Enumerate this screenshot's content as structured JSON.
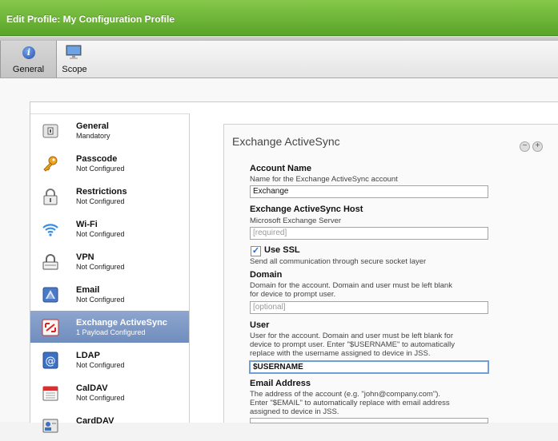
{
  "window": {
    "title": "Edit Profile: My Configuration Profile"
  },
  "tabs": [
    {
      "label": "General"
    },
    {
      "label": "Scope"
    }
  ],
  "sidebar": {
    "items": [
      {
        "name": "General",
        "status": "Mandatory"
      },
      {
        "name": "Passcode",
        "status": "Not Configured"
      },
      {
        "name": "Restrictions",
        "status": "Not Configured"
      },
      {
        "name": "Wi-Fi",
        "status": "Not Configured"
      },
      {
        "name": "VPN",
        "status": "Not Configured"
      },
      {
        "name": "Email",
        "status": "Not Configured"
      },
      {
        "name": "Exchange ActiveSync",
        "status": "1 Payload Configured"
      },
      {
        "name": "LDAP",
        "status": "Not Configured"
      },
      {
        "name": "CalDAV",
        "status": "Not Configured"
      },
      {
        "name": "CardDAV",
        "status": ""
      }
    ]
  },
  "panel": {
    "title": "Exchange ActiveSync",
    "minus": "−",
    "plus": "+",
    "account_name": {
      "label": "Account Name",
      "desc": "Name for the Exchange ActiveSync account",
      "value": "Exchange"
    },
    "host": {
      "label": "Exchange ActiveSync Host",
      "desc": "Microsoft Exchange Server",
      "placeholder": "[required]"
    },
    "ssl": {
      "label": "Use SSL",
      "desc": "Send all communication through secure socket layer",
      "check": "✓"
    },
    "domain": {
      "label": "Domain",
      "desc1": "Domain for the account. Domain and user must be left blank",
      "desc2": "for device to prompt user.",
      "placeholder": "[optional]"
    },
    "user": {
      "label": "User",
      "desc1": "User for the account. Domain and user must be left blank for",
      "desc2": "device to prompt user. Enter \"$USERNAME\" to automatically",
      "desc3": "replace with the username assigned to device in JSS.",
      "value": "$USERNAME"
    },
    "email": {
      "label": "Email Address",
      "desc1": "The address of the account (e.g. \"john@company.com\").",
      "desc2": "Enter \"$EMAIL\" to automatically replace with email address",
      "desc3": "assigned to device in JSS."
    }
  },
  "colors": {
    "titlebar": "#6bb536",
    "selected": "#7b97c6"
  }
}
